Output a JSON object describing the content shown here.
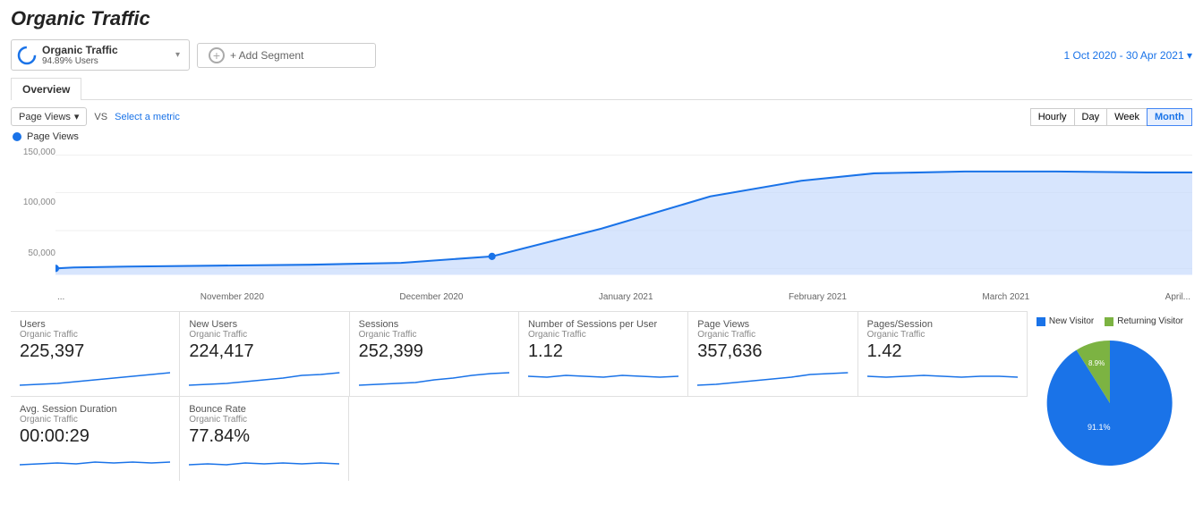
{
  "title": "Organic Traffic",
  "segment": {
    "name": "Organic Traffic",
    "percentage": "94.89% Users",
    "chevron": "▾"
  },
  "add_segment_label": "+ Add Segment",
  "date_range": "1 Oct 2020 - 30 Apr 2021",
  "tabs": [
    "Overview"
  ],
  "active_tab": "Overview",
  "chart": {
    "metric_label": "Page Views",
    "metric_dropdown_arrow": "▾",
    "vs_label": "VS",
    "select_metric_label": "Select a metric",
    "time_buttons": [
      "Hourly",
      "Day",
      "Week",
      "Month"
    ],
    "active_time": "Month",
    "legend_label": "Page Views",
    "y_axis": [
      "150,000",
      "100,000",
      "50,000",
      ""
    ],
    "x_axis": [
      "",
      "November 2020",
      "December 2020",
      "January 2021",
      "February 2021",
      "March 2021",
      "April..."
    ]
  },
  "metrics": [
    {
      "title": "Users",
      "sub": "Organic Traffic",
      "value": "225,397"
    },
    {
      "title": "New Users",
      "sub": "Organic Traffic",
      "value": "224,417"
    },
    {
      "title": "Sessions",
      "sub": "Organic Traffic",
      "value": "252,399"
    },
    {
      "title": "Number of Sessions per User",
      "sub": "Organic Traffic",
      "value": "1.12"
    },
    {
      "title": "Page Views",
      "sub": "Organic Traffic",
      "value": "357,636"
    },
    {
      "title": "Pages/Session",
      "sub": "Organic Traffic",
      "value": "1.42"
    },
    {
      "title": "Avg. Session Duration",
      "sub": "Organic Traffic",
      "value": "00:00:29"
    },
    {
      "title": "Bounce Rate",
      "sub": "Organic Traffic",
      "value": "77.84%"
    }
  ],
  "pie": {
    "legend": {
      "new_visitor": "New Visitor",
      "returning_visitor": "Returning Visitor"
    },
    "new_visitor_pct": "91.1%",
    "returning_visitor_pct": "8.9%",
    "new_visitor_color": "#1a73e8",
    "returning_visitor_color": "#7cb342"
  },
  "colors": {
    "accent_blue": "#1a73e8",
    "chart_fill": "#c6dafc",
    "chart_line": "#1a73e8"
  }
}
